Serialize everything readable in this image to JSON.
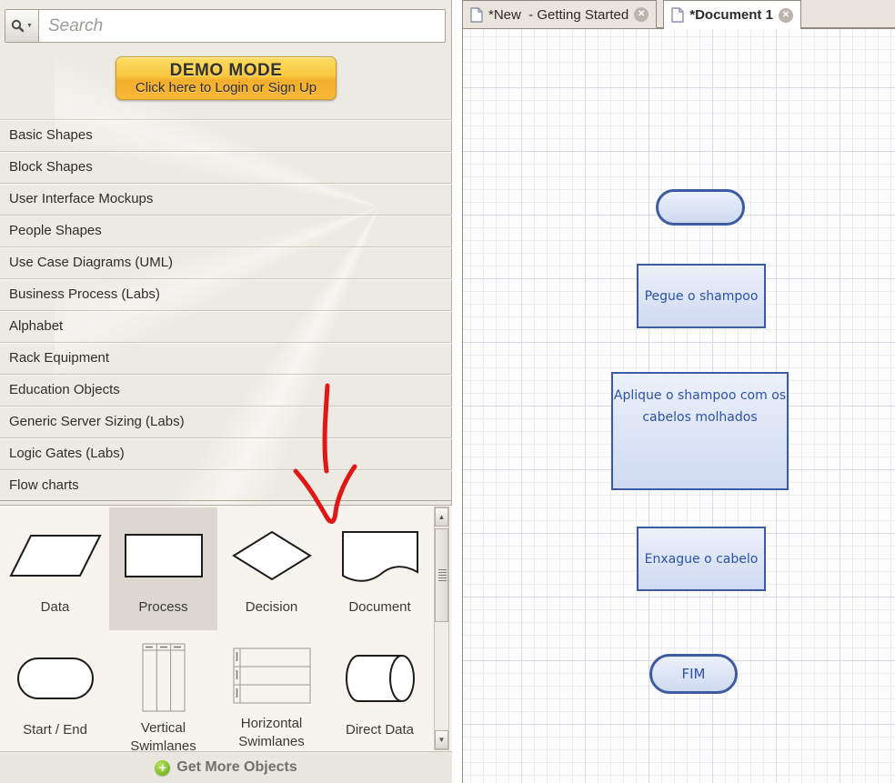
{
  "sidebar": {
    "search": {
      "placeholder": "Search"
    },
    "demo_button": {
      "title": "DEMO MODE",
      "subtitle": "Click here to Login or Sign Up"
    },
    "categories": [
      {
        "label": "Basic Shapes"
      },
      {
        "label": "Block Shapes"
      },
      {
        "label": "User Interface Mockups"
      },
      {
        "label": "People Shapes"
      },
      {
        "label": "Use Case Diagrams (UML)"
      },
      {
        "label": "Business Process (Labs)"
      },
      {
        "label": "Alphabet"
      },
      {
        "label": "Rack Equipment"
      },
      {
        "label": "Education Objects"
      },
      {
        "label": "Generic Server Sizing (Labs)"
      },
      {
        "label": "Logic Gates (Labs)"
      },
      {
        "label": "Flow charts"
      }
    ],
    "shapes": [
      {
        "label": "Data",
        "selected": false
      },
      {
        "label": "Process",
        "selected": true
      },
      {
        "label": "Decision",
        "selected": false
      },
      {
        "label": "Document",
        "selected": false
      },
      {
        "label": "Start / End",
        "selected": false
      },
      {
        "label": "Vertical Swimlanes",
        "selected": false
      },
      {
        "label": "Horizontal Swimlanes",
        "selected": false
      },
      {
        "label": "Direct Data",
        "selected": false
      }
    ],
    "get_more_label": "Get More Objects"
  },
  "tabs": [
    {
      "label": "*New  - Getting Started",
      "active": false
    },
    {
      "label": "*Document 1",
      "active": true
    }
  ],
  "canvas": {
    "nodes": [
      {
        "type": "start-end",
        "text": ""
      },
      {
        "type": "process",
        "text": "Pegue o shampoo"
      },
      {
        "type": "process",
        "text": "Aplique o shampoo com os cabelos molhados"
      },
      {
        "type": "process",
        "text": "Enxague o cabelo"
      },
      {
        "type": "start-end",
        "text": "FIM"
      }
    ]
  },
  "annotation": {
    "type": "hand-drawn-red-arrow",
    "points_at": "Document shape",
    "color": "#e01715"
  },
  "icons": {
    "close": "✕",
    "plus": "+",
    "scroll_up": "▲",
    "scroll_down": "▼",
    "search_dropdown": "▼"
  },
  "colors": {
    "sidebar_bg": "#edeae3",
    "demo_gradient_top": "#fddd64",
    "demo_gradient_bottom": "#f6b737",
    "selected_cell_bg": "#dcd8d0",
    "node_border": "#3c5ba0",
    "node_fill_top": "#ebf1fa",
    "node_fill_bottom": "#cfdaf1",
    "node_text": "#2d50a8",
    "annotation_red": "#e01715"
  }
}
